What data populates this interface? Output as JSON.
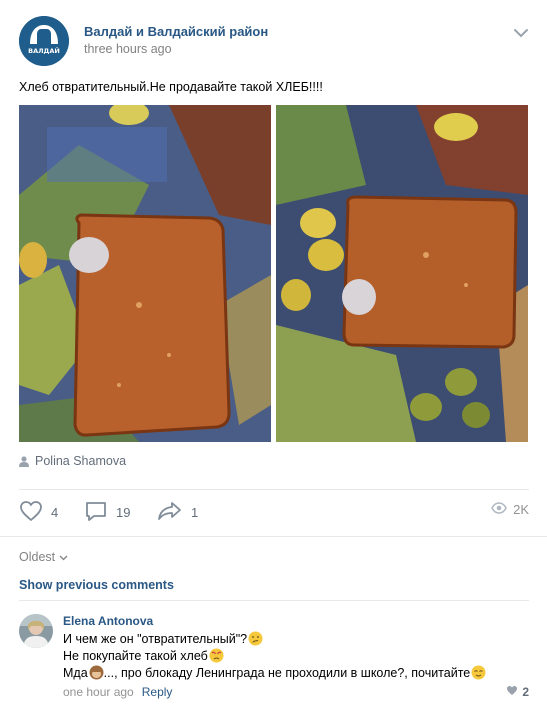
{
  "post": {
    "community_name": "Валдай и Валдайский район",
    "avatar_text": "ВАЛДАЙ",
    "time": "three hours ago",
    "text": "Хлеб отвратительный.Не продавайте такой ХЛЕБ!!!!",
    "photo_author": "Polina Shamova",
    "likes": "4",
    "comments": "19",
    "shares": "1",
    "views": "2K"
  },
  "comments_section": {
    "sort_label": "Oldest",
    "show_previous": "Show previous comments",
    "items": [
      {
        "author": "Elena Antonova",
        "line1": "И чем же он \"отвратительный\"?",
        "line2": "Не покупайте такой хлеб",
        "line3_start": "Мда",
        "line3_end": "..., про блокаду Ленинграда не проходили в школе?, почитайте",
        "time": "one hour ago",
        "reply": "Reply",
        "likes": "2"
      }
    ]
  },
  "colors": {
    "link": "#2a5885",
    "secondary": "#828282",
    "icon": "#626d7a",
    "avatar_bg": "#1f5d8c"
  },
  "icons": [
    "chevron-down-icon",
    "user-icon",
    "heart-icon",
    "comment-icon",
    "share-icon",
    "eye-icon"
  ]
}
